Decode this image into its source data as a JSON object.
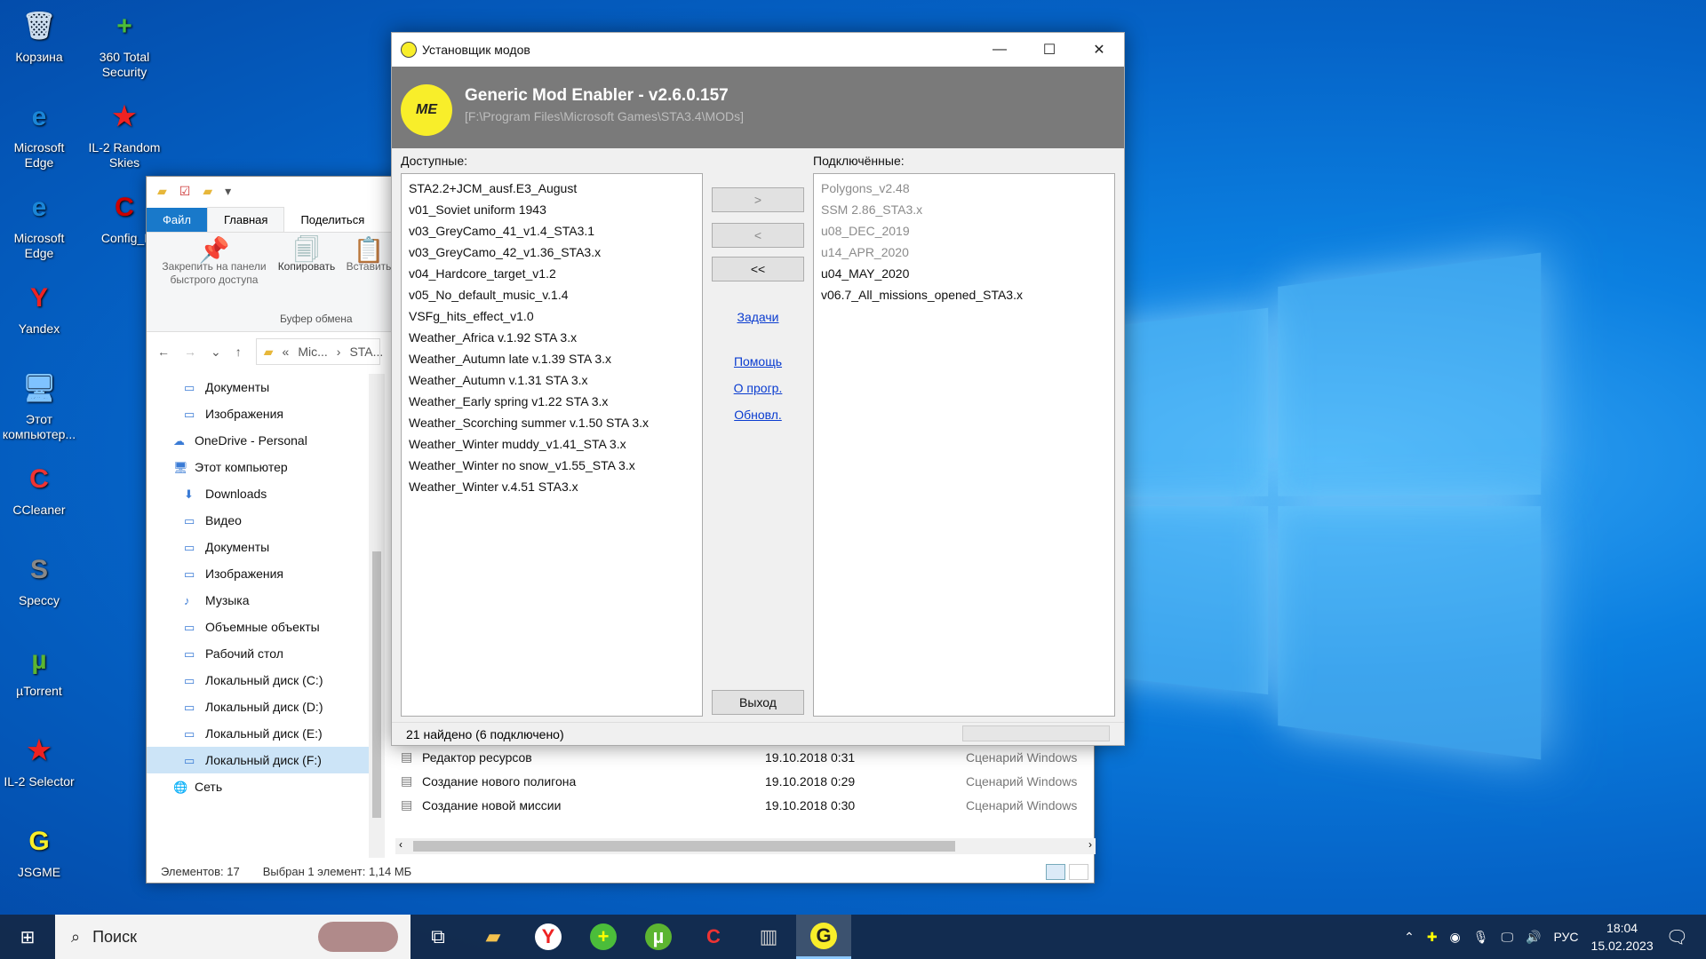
{
  "desktop": {
    "icons": [
      {
        "label": "Корзина",
        "glyph": "🗑"
      },
      {
        "label": "360 Total Security",
        "glyph": "+"
      },
      {
        "label": "Microsoft Edge",
        "glyph": "e"
      },
      {
        "label": "IL-2 Random Skies",
        "glyph": "★"
      },
      {
        "label": "Microsoft Edge",
        "glyph": "e"
      },
      {
        "label": "Config_I",
        "glyph": "C"
      },
      {
        "label": "Yandex",
        "glyph": "Y"
      },
      {
        "label": "Этот компьютер...",
        "glyph": "🖥"
      },
      {
        "label": "CCleaner",
        "glyph": "C"
      },
      {
        "label": "Speccy",
        "glyph": "S"
      },
      {
        "label": "µTorrent",
        "glyph": "µ"
      },
      {
        "label": "IL-2 Selector",
        "glyph": "★"
      },
      {
        "label": "JSGME",
        "glyph": "G"
      }
    ]
  },
  "explorer": {
    "tabs": {
      "file": "Файл",
      "home": "Главная",
      "share": "Поделиться"
    },
    "ribbon": {
      "pin": "Закрепить на панели быстрого доступа",
      "copy": "Копировать",
      "paste": "Вставить",
      "group": "Буфер обмена"
    },
    "address": {
      "part1": "Mic...",
      "part2": "STA..."
    },
    "nav": [
      {
        "label": "Документы",
        "indent": 1
      },
      {
        "label": "Изображения",
        "indent": 1
      },
      {
        "label": "OneDrive - Personal",
        "indent": 0
      },
      {
        "label": "Этот компьютер",
        "indent": 0
      },
      {
        "label": "Downloads",
        "indent": 1
      },
      {
        "label": "Видео",
        "indent": 1
      },
      {
        "label": "Документы",
        "indent": 1
      },
      {
        "label": "Изображения",
        "indent": 1
      },
      {
        "label": "Музыка",
        "indent": 1
      },
      {
        "label": "Объемные объекты",
        "indent": 1
      },
      {
        "label": "Рабочий стол",
        "indent": 1
      },
      {
        "label": "Локальный диск (C:)",
        "indent": 1
      },
      {
        "label": "Локальный диск  (D:)",
        "indent": 1
      },
      {
        "label": "Локальный диск (E:)",
        "indent": 1
      },
      {
        "label": "Локальный диск (F:)",
        "indent": 1,
        "selected": true
      },
      {
        "label": "Сеть",
        "indent": 0
      }
    ],
    "files": [
      {
        "name": "Редактор ресурсов",
        "date": "19.10.2018 0:31",
        "type": "Сценарий Windows"
      },
      {
        "name": "Создание нового полигона",
        "date": "19.10.2018 0:29",
        "type": "Сценарий Windows"
      },
      {
        "name": "Создание новой миссии",
        "date": "19.10.2018 0:30",
        "type": "Сценарий Windows"
      }
    ],
    "status": {
      "count": "Элементов: 17",
      "selected": "Выбран 1 элемент: 1,14 МБ"
    }
  },
  "gme": {
    "window_title": "Установщик модов",
    "app_name": "Generic Mod Enabler - v2.6.0.157",
    "path": "[F:\\Program Files\\Microsoft Games\\STA3.4\\MODs]",
    "logo_text": "ME",
    "available_label": "Доступные:",
    "enabled_label": "Подключённые:",
    "available": [
      "STA2.2+JCM_ausf.E3_August",
      "v01_Soviet uniform 1943",
      "v03_GreyCamo_41_v1.4_STA3.1",
      "v03_GreyCamo_42_v1.36_STA3.x",
      "v04_Hardcore_target_v1.2",
      "v05_No_default_music_v.1.4",
      "VSFg_hits_effect_v1.0",
      "Weather_Africa v.1.92 STA 3.x",
      "Weather_Autumn late v.1.39 STA 3.x",
      "Weather_Autumn v.1.31 STA 3.x",
      "Weather_Early spring v1.22 STA 3.x",
      "Weather_Scorching summer v.1.50 STA 3.x",
      "Weather_Winter muddy_v1.41_STA 3.x",
      "Weather_Winter no snow_v1.55_STA 3.x",
      "Weather_Winter v.4.51 STA3.x"
    ],
    "enabled": [
      {
        "name": "Polygons_v2.48",
        "dim": true
      },
      {
        "name": "SSM 2.86_STA3.x",
        "dim": true
      },
      {
        "name": "u08_DEC_2019",
        "dim": true
      },
      {
        "name": "u14_APR_2020",
        "dim": true
      },
      {
        "name": "u04_MAY_2020",
        "dim": false
      },
      {
        "name": "v06.7_All_missions_opened_STA3.x",
        "dim": false
      }
    ],
    "buttons": {
      "enable": ">",
      "disable": "<",
      "disable_all": "<<",
      "exit": "Выход"
    },
    "links": {
      "tasks": "Задачи",
      "help": "Помощь",
      "about": "О прогр.",
      "update": "Обновл."
    },
    "status": "21 найдено  (6 подключено)"
  },
  "taskbar": {
    "search": "Поиск",
    "lang": "РУС",
    "time": "18:04",
    "date": "15.02.2023"
  }
}
